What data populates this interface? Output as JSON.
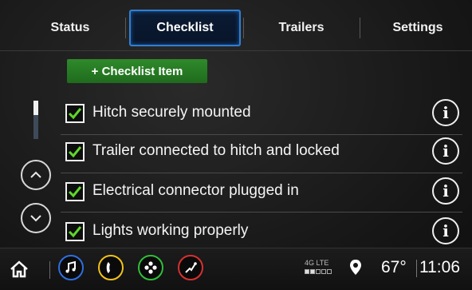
{
  "tabs": [
    {
      "label": "Status",
      "active": false
    },
    {
      "label": "Checklist",
      "active": true
    },
    {
      "label": "Trailers",
      "active": false
    },
    {
      "label": "Settings",
      "active": false
    }
  ],
  "add_button": {
    "label": "+ Checklist Item"
  },
  "checklist": [
    {
      "label": "Hitch securely mounted",
      "checked": true
    },
    {
      "label": "Trailer connected to hitch and locked",
      "checked": true
    },
    {
      "label": "Electrical connector plugged in",
      "checked": true
    },
    {
      "label": "Lights working properly",
      "checked": true
    }
  ],
  "status_bar": {
    "network": "4G LTE",
    "signal_bars": 2,
    "temperature": "67°",
    "time": "11:06"
  },
  "colors": {
    "accent_blue": "#2f7fd6",
    "add_green": "#2a8a26",
    "check_green": "#5ed62a",
    "music_blue": "#2f6fe0",
    "phone_yellow": "#f2c21b",
    "apps_green": "#2fbf3a",
    "nav_red": "#d93030"
  },
  "icons": [
    "home-icon",
    "music-icon",
    "phone-icon",
    "apps-icon",
    "navigation-icon",
    "location-pin-icon",
    "info-icon",
    "chevron-up-icon",
    "chevron-down-icon",
    "checkmark-icon"
  ]
}
